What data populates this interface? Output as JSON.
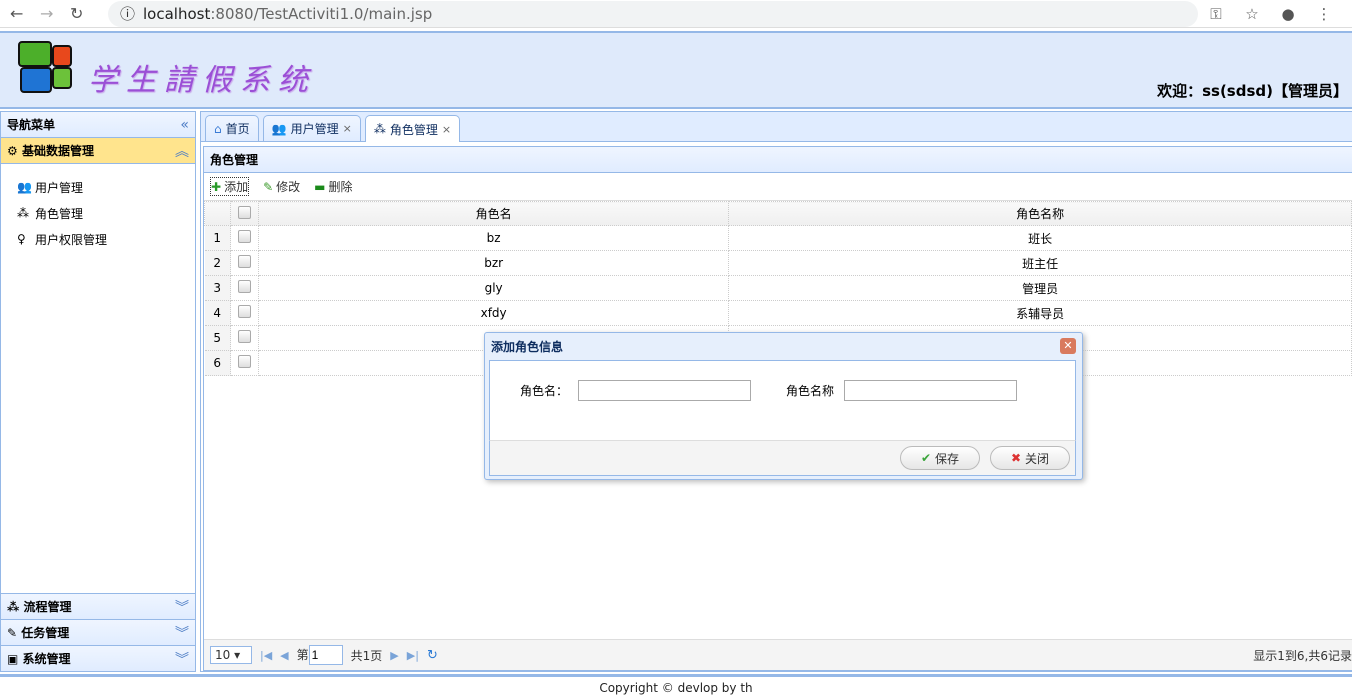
{
  "browser": {
    "url_host": "localhost",
    "url_path": ":8080/TestActiviti1.0/main.jsp"
  },
  "header": {
    "title": "学生請假系统",
    "welcome": "欢迎：ss(sdsd)【管理员】"
  },
  "west": {
    "title": "导航菜单",
    "sections": [
      {
        "label": "基础数据管理",
        "items": [
          "用户管理",
          "角色管理",
          "用户权限管理"
        ]
      },
      {
        "label": "流程管理"
      },
      {
        "label": "任务管理"
      },
      {
        "label": "系统管理"
      }
    ]
  },
  "tabs": [
    {
      "label": "首页"
    },
    {
      "label": "用户管理"
    },
    {
      "label": "角色管理"
    }
  ],
  "panel": {
    "title": "角色管理",
    "toolbar": {
      "add": "添加",
      "edit": "修改",
      "delete": "删除"
    }
  },
  "grid": {
    "columns": [
      "角色名",
      "角色名称"
    ],
    "rows": [
      {
        "n": "1",
        "name": "bz",
        "label": "班长"
      },
      {
        "n": "2",
        "name": "bzr",
        "label": "班主任"
      },
      {
        "n": "3",
        "name": "gly",
        "label": "管理员"
      },
      {
        "n": "4",
        "name": "xfdy",
        "label": "系辅导员"
      },
      {
        "n": "5",
        "name": "",
        "label": ""
      },
      {
        "n": "6",
        "name": "",
        "label": ""
      }
    ]
  },
  "pager": {
    "page_size": "10",
    "page_prefix": "第",
    "page": "1",
    "page_total": "共1页",
    "info": "显示1到6,共6记录"
  },
  "footer": "Copyright © devlop by th",
  "dialog": {
    "title": "添加角色信息",
    "field1_label": "角色名：",
    "field2_label": "角色名称",
    "save": "保存",
    "close": "关闭"
  }
}
